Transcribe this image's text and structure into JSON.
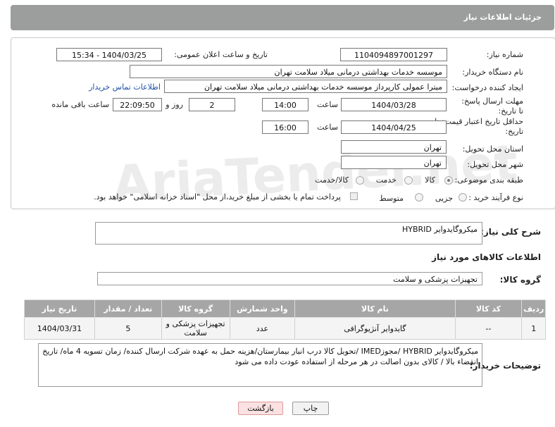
{
  "header": {
    "title": "جزئیات اطلاعات نیاز"
  },
  "form": {
    "need_number_label": "شماره نیاز:",
    "need_number": "1104094897001297",
    "announce_label": "تاریخ و ساعت اعلان عمومی:",
    "announce_value": "1404/03/25 - 15:34",
    "buyer_org_label": "نام دستگاه خریدار:",
    "buyer_org": "موسسه خدمات بهداشتی درمانی میلاد سلامت تهران",
    "creator_label": "ایجاد کننده درخواست:",
    "creator": "میترا عمولی کارپرداز موسسه خدمات بهداشتی درمانی میلاد سلامت تهران",
    "contact_link": "اطلاعات تماس خریدار",
    "deadline_label": "مهلت ارسال پاسخ: تا تاریخ:",
    "deadline_date": "1404/03/28",
    "time_label": "ساعت",
    "deadline_time": "14:00",
    "days_value": "2",
    "days_label": "روز و",
    "remaining_time": "22:09:50",
    "remaining_label": "ساعت باقی مانده",
    "min_price_label": "حداقل تاریخ اعتبار قیمت: تا تاریخ:",
    "min_price_date": "1404/04/25",
    "min_price_time": "16:00",
    "province_label": "استان محل تحویل:",
    "province": "تهران",
    "city_label": "شهر محل تحویل:",
    "city": "تهران",
    "category_label": "طبقه بندی موضوعی:",
    "category_options": [
      "کالا",
      "خدمت",
      "کالا/خدمت"
    ],
    "purchase_type_label": "نوع فرآیند خرید :",
    "purchase_options": [
      "جزیی",
      "متوسط"
    ],
    "payment_note": "پرداخت تمام یا بخشی از مبلغ خرید،از محل \"اسناد خزانه اسلامی\" خواهد بود."
  },
  "description": {
    "label": "شرح کلی نیاز:",
    "value": "میکروگایدوایر HYBRID"
  },
  "goods_info_title": "اطلاعات کالاهای مورد نیاز",
  "goods_group": {
    "label": "گروه کالا:",
    "value": "تجهیزات پزشکی و سلامت"
  },
  "table": {
    "headers": [
      "ردیف",
      "کد کالا",
      "نام کالا",
      "واحد شمارش",
      "گروه کالا",
      "تعداد / مقدار",
      "تاریخ نیاز"
    ],
    "rows": [
      [
        "1",
        "--",
        "گایدوایر آنژیوگرافی",
        "عدد",
        "تجهیزات پزشکی و سلامت",
        "5",
        "1404/03/31"
      ]
    ]
  },
  "buyer_notes": {
    "label": "توضیحات خریدار:",
    "value": "میکروگایدوایر HYBRID /مجوزIMED /تحویل کالا درب انبار بیمارستان/هزینه حمل به عهده شرکت ارسال کننده/ زمان تسویه 4 ماه/ تاریخ انقضاء بالا / کالای بدون اصالت در هر مرحله از استفاده عودت داده می شود"
  },
  "buttons": {
    "print": "چاپ",
    "back": "بازگشت"
  },
  "watermark": "AriaTender.net"
}
